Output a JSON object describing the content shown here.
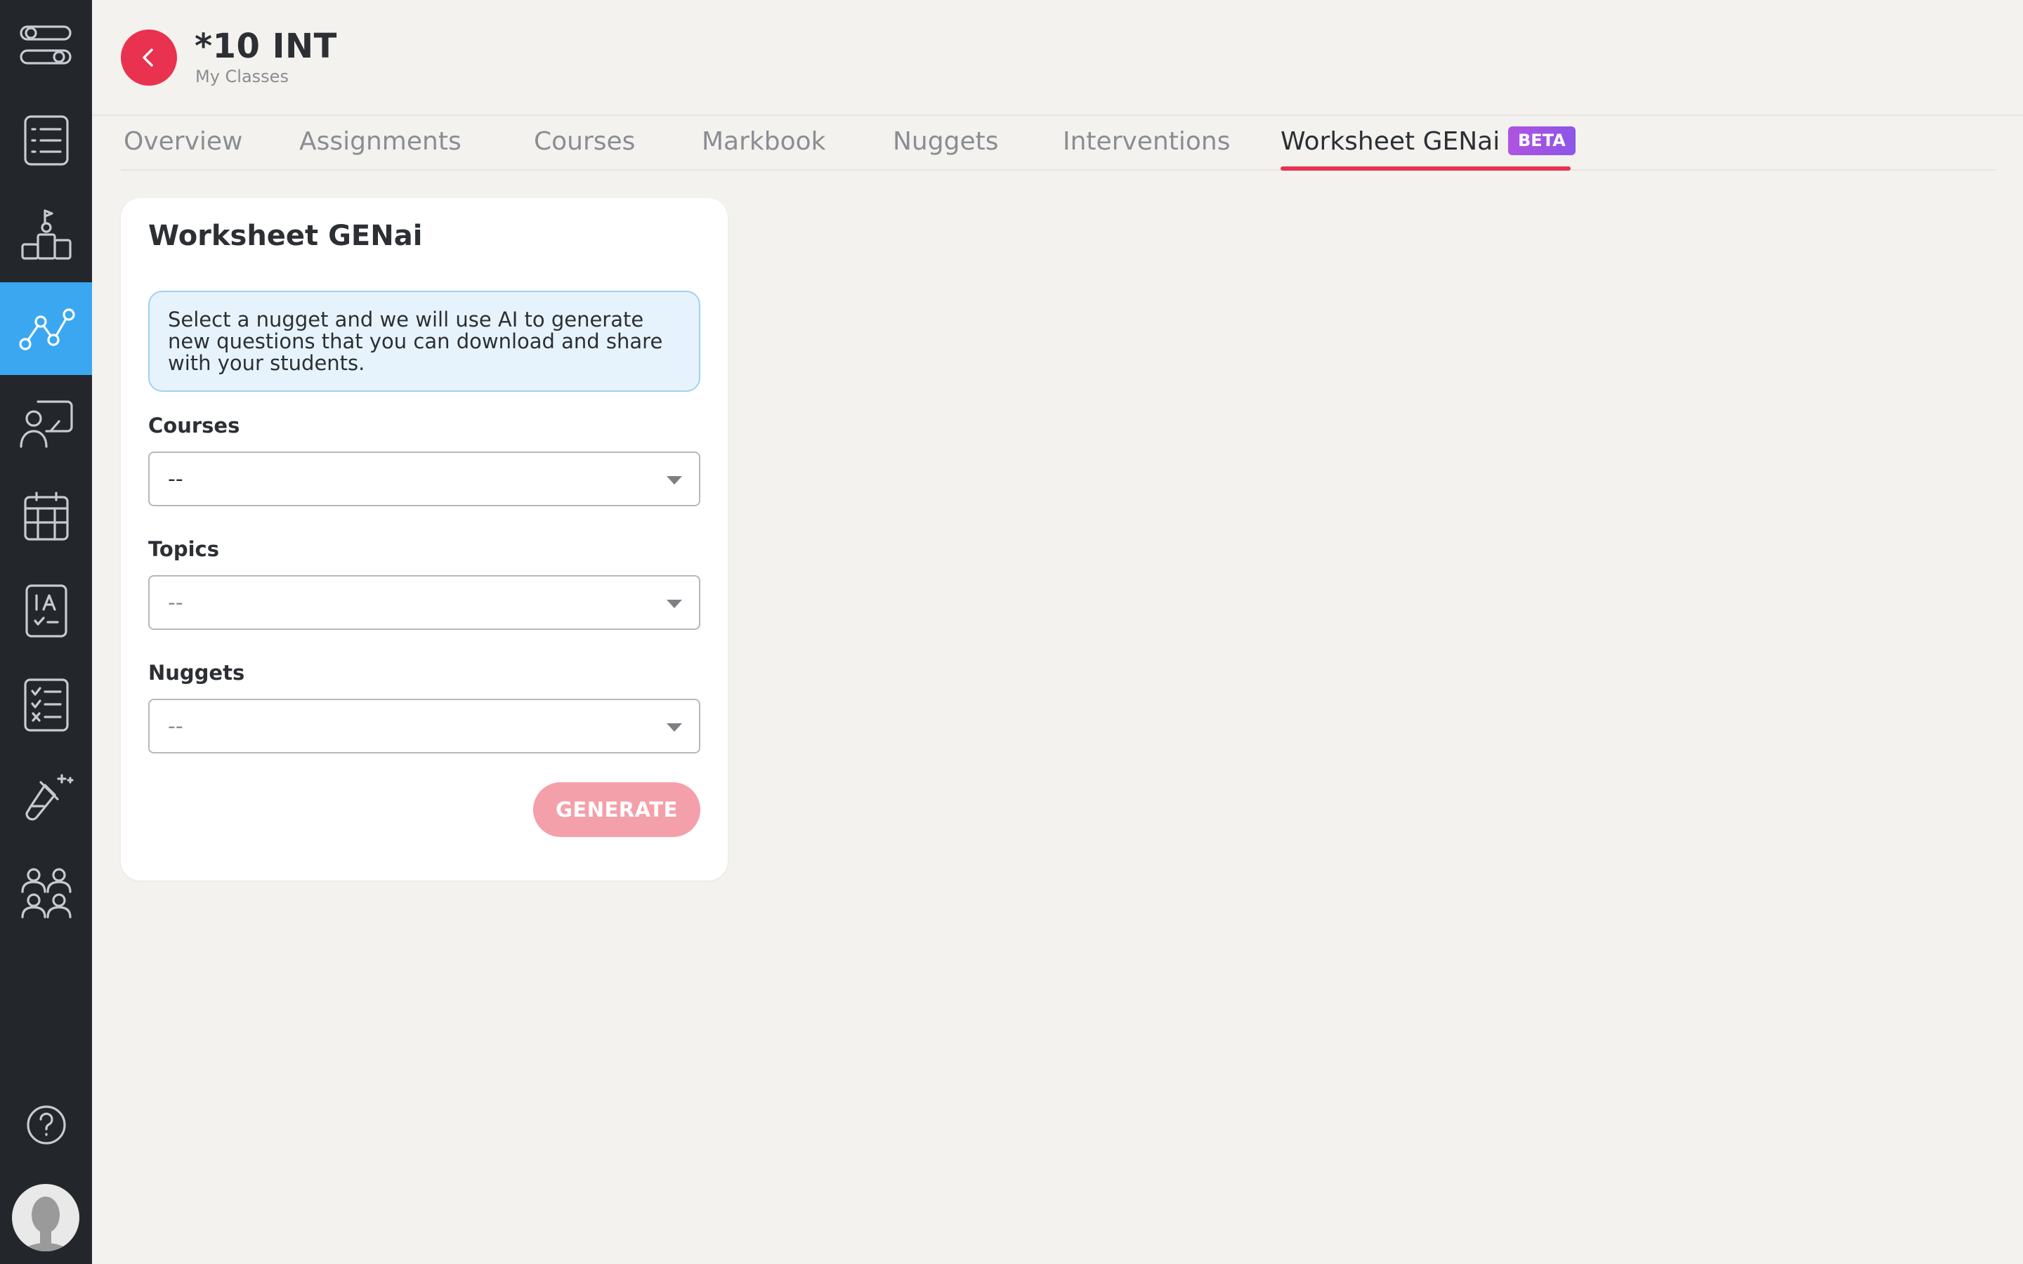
{
  "app": {
    "accent_color": "#e8324f",
    "sidebar_bg": "#23272c",
    "sidebar_active_color": "#3ba7f0"
  },
  "sidebar": {
    "items": [
      {
        "icon": "sliders-icon",
        "active": false
      },
      {
        "icon": "list-icon",
        "active": false
      },
      {
        "icon": "podium-icon",
        "active": false
      },
      {
        "icon": "analytics-icon",
        "active": true
      },
      {
        "icon": "teacher-board-icon",
        "active": false
      },
      {
        "icon": "calendar-icon",
        "active": false
      },
      {
        "icon": "assessment-icon",
        "active": false
      },
      {
        "icon": "checklist-icon",
        "active": false
      },
      {
        "icon": "flask-sparkle-icon",
        "active": false
      },
      {
        "icon": "students-group-icon",
        "active": false
      }
    ],
    "help_icon": "help-icon",
    "avatar_icon": "user-avatar-icon"
  },
  "header": {
    "class_name": "*10 INT",
    "breadcrumb": "My Classes"
  },
  "tabs": [
    {
      "label": "Overview",
      "active": false
    },
    {
      "label": "Assignments",
      "active": false
    },
    {
      "label": "Courses",
      "active": false
    },
    {
      "label": "Markbook",
      "active": false
    },
    {
      "label": "Nuggets",
      "active": false
    },
    {
      "label": "Interventions",
      "active": false
    },
    {
      "label": "Worksheet GENai",
      "active": true,
      "badge": "BETA"
    }
  ],
  "card": {
    "title": "Worksheet GENai",
    "info": "Select a nugget and we will use AI to generate new questions that you can download and share with your students.",
    "fields": {
      "courses": {
        "label": "Courses",
        "value": "--"
      },
      "topics": {
        "label": "Topics",
        "value": "--"
      },
      "nuggets": {
        "label": "Nuggets",
        "value": "--"
      }
    },
    "generate_label": "GENERATE"
  }
}
